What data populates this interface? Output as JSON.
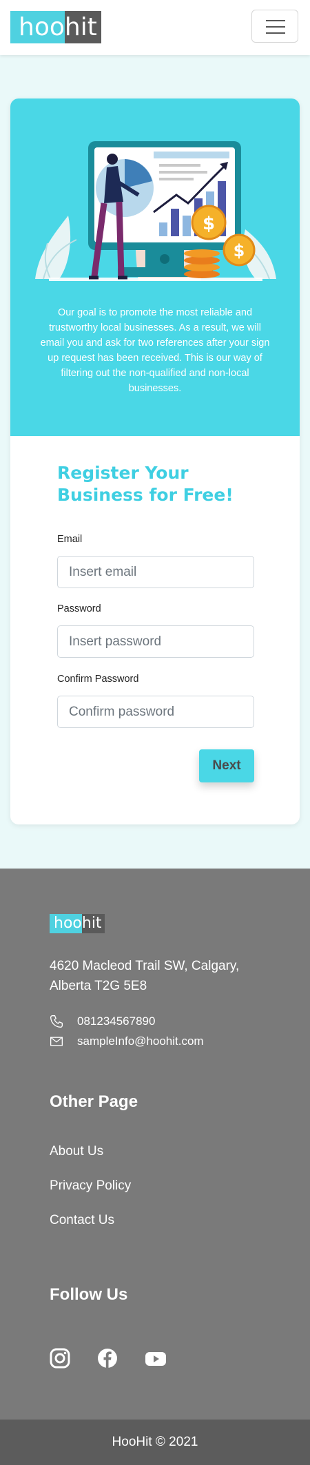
{
  "header": {
    "logo_left": "hoo",
    "logo_right": "hit",
    "menu_icon": "hamburger-icon"
  },
  "hero": {
    "illustration": "business-growth-illustration",
    "intro_text": "Our goal is to promote the most reliable and trustworthy local businesses. As a result, we will email you and ask for two references after your sign up request has been received. This is our way of filtering out the non-qualified and non-local businesses."
  },
  "form": {
    "title": "Register Your Business for Free!",
    "email_label": "Email",
    "email_placeholder": "Insert email",
    "email_value": "",
    "password_label": "Password",
    "password_placeholder": "Insert password",
    "password_value": "",
    "confirm_label": "Confirm Password",
    "confirm_placeholder": "Confirm password",
    "confirm_value": "",
    "next_label": "Next"
  },
  "footer": {
    "logo_left": "hoo",
    "logo_right": "hit",
    "address": "4620 Macleod Trail SW, Calgary, Alberta T2G 5E8",
    "phone_icon": "phone-icon",
    "phone": "081234567890",
    "email_icon": "envelope-icon",
    "email": "sampleInfo@hoohit.com",
    "other_heading": "Other Page",
    "links": [
      "About Us",
      "Privacy Policy",
      "Contact Us"
    ],
    "follow_heading": "Follow Us",
    "social_icons": [
      "instagram-icon",
      "facebook-icon",
      "youtube-icon"
    ],
    "copyright": "HooHit © 2021"
  },
  "colors": {
    "accent": "#4ad7e6",
    "footer_bg": "#7a7a7a",
    "copyright_bg": "#5c5c5c",
    "logo_dark": "#5a5a5a"
  }
}
